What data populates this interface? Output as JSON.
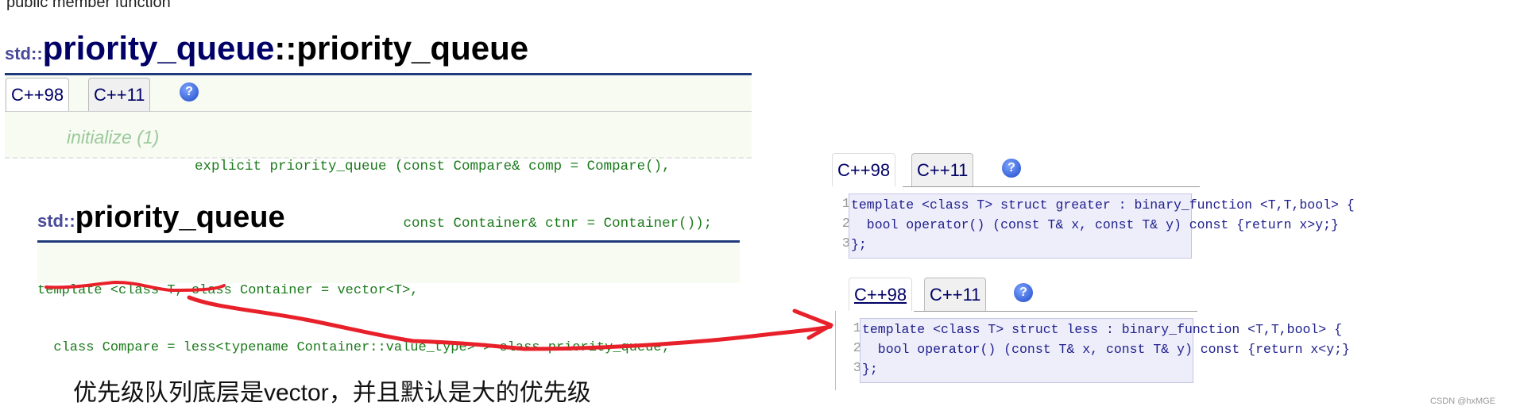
{
  "top_section": {
    "cut_text": "public member function",
    "title_ns": "std::",
    "title_class": "priority_queue",
    "title_sep": "::",
    "title_fn": "priority_queue",
    "tabs": [
      {
        "label": "C++98",
        "active": true
      },
      {
        "label": "C++11",
        "active": false
      }
    ],
    "help_icon": "?",
    "overload_label": "initialize (1)",
    "code_lines": [
      "explicit priority_queue (const Compare& comp = Compare(),",
      "                         const Container& ctnr = Container());"
    ]
  },
  "class_section": {
    "title_ns": "std::",
    "title": "priority_queue",
    "code_lines": [
      "template <class T, class Container = vector<T>,",
      "  class Compare = less<typename Container::value_type> > class priority_queue;"
    ]
  },
  "annotation": {
    "note": "优先级队列底层是vector，并且默认是大的优先级",
    "color": "#e8202a"
  },
  "greater_section": {
    "tabs": [
      {
        "label": "C++98",
        "active": true
      },
      {
        "label": "C++11",
        "active": false
      }
    ],
    "help_icon": "?",
    "line_numbers": [
      "1",
      "2",
      "3"
    ],
    "code_lines": [
      "template <class T> struct greater : binary_function <T,T,bool> {",
      "  bool operator() (const T& x, const T& y) const {return x>y;}",
      "};"
    ]
  },
  "less_section": {
    "tabs": [
      {
        "label": "C++98",
        "active": true
      },
      {
        "label": "C++11",
        "active": false
      }
    ],
    "help_icon": "?",
    "line_numbers": [
      "1",
      "2",
      "3"
    ],
    "code_lines": [
      "template <class T> struct less : binary_function <T,T,bool> {",
      "  bool operator() (const T& x, const T& y) const {return x<y;}",
      "};"
    ]
  },
  "watermark": "CSDN @hxMGE"
}
